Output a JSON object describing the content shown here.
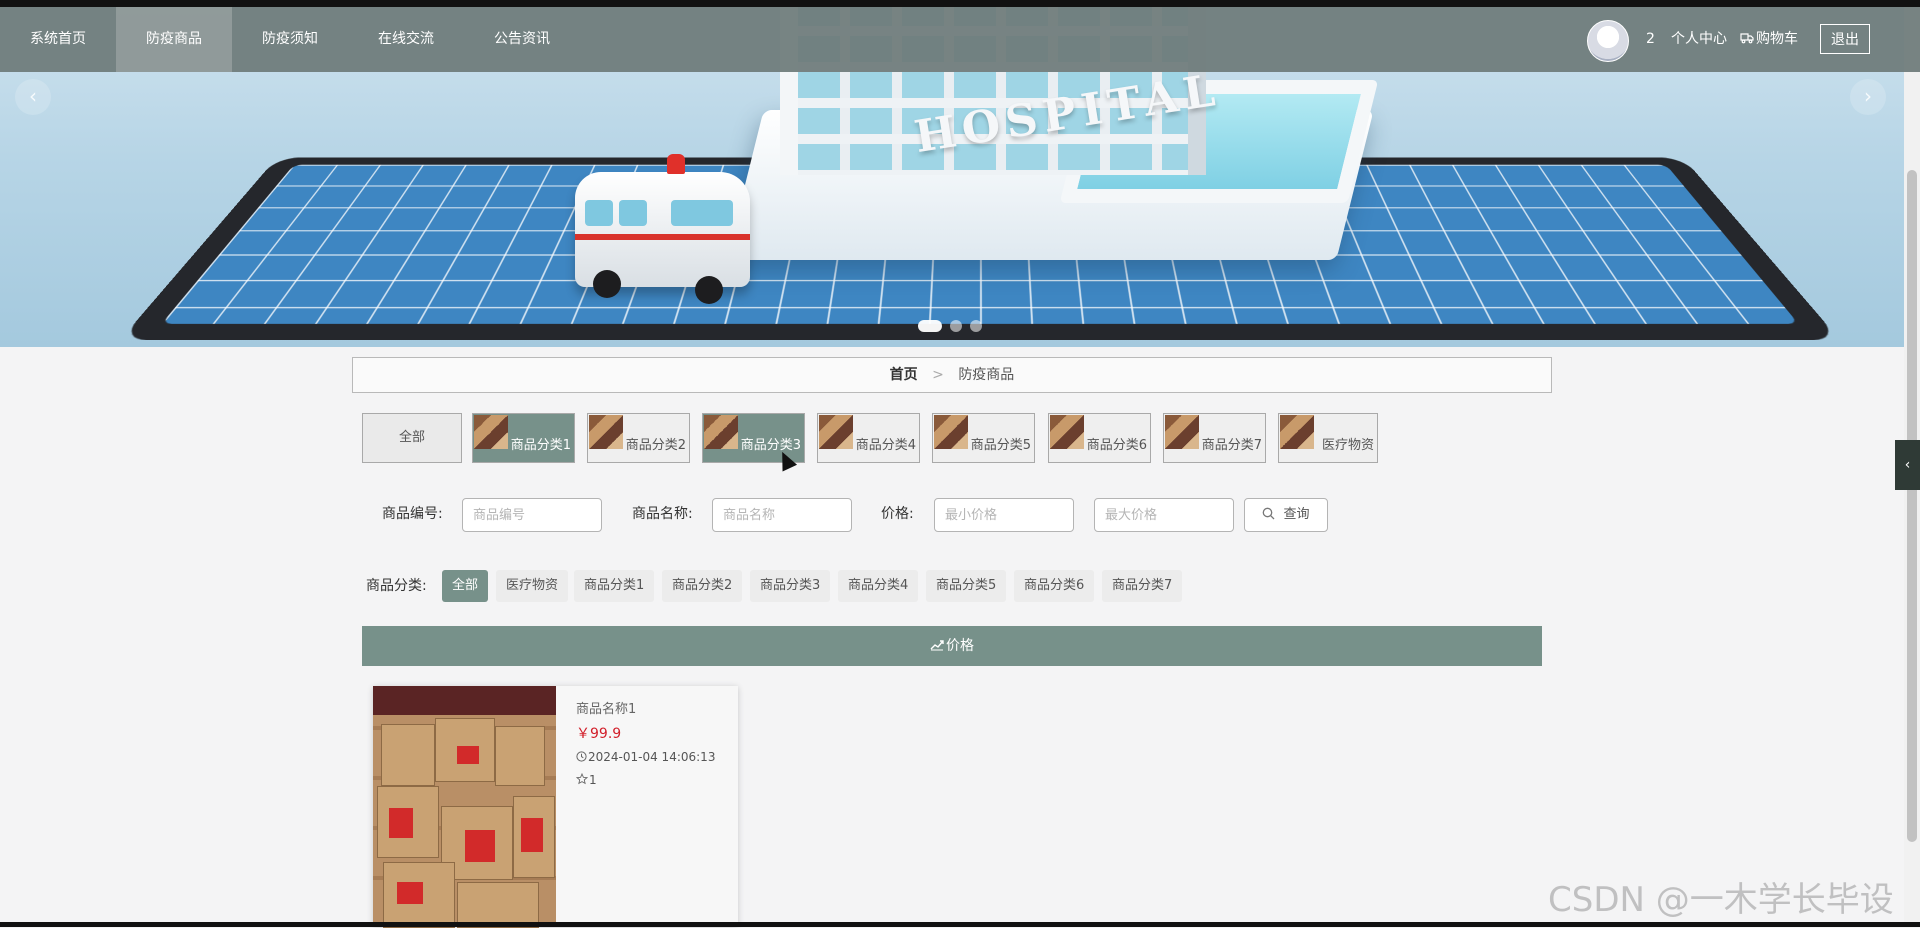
{
  "nav": {
    "items": [
      {
        "label": "系统首页"
      },
      {
        "label": "防疫商品"
      },
      {
        "label": "防疫须知"
      },
      {
        "label": "在线交流"
      },
      {
        "label": "公告资讯"
      }
    ],
    "user_count": "2",
    "personal_center": "个人中心",
    "cart_icon": "truck-icon",
    "cart": "购物车",
    "logout": "退出"
  },
  "banner": {
    "sign_text": "HOSPITAL",
    "prev_arrow": "‹",
    "next_arrow": "›",
    "slide_count": 3,
    "active_slide": 1
  },
  "breadcrumb": {
    "home": "首页",
    "separator": ">",
    "current": "防疫商品"
  },
  "category_tabs": [
    {
      "label": "全部"
    },
    {
      "label": "商品分类1"
    },
    {
      "label": "商品分类2"
    },
    {
      "label": "商品分类3"
    },
    {
      "label": "商品分类4"
    },
    {
      "label": "商品分类5"
    },
    {
      "label": "商品分类6"
    },
    {
      "label": "商品分类7"
    },
    {
      "label": "医疗物资"
    }
  ],
  "search": {
    "code_label": "商品编号:",
    "code_placeholder": "商品编号",
    "name_label": "商品名称:",
    "name_placeholder": "商品名称",
    "price_label": "价格:",
    "min_placeholder": "最小价格",
    "max_placeholder": "最大价格",
    "query_icon": "search-icon",
    "query_button": "查询"
  },
  "filter": {
    "label": "商品分类:",
    "chips": [
      "全部",
      "医疗物资",
      "商品分类1",
      "商品分类2",
      "商品分类3",
      "商品分类4",
      "商品分类5",
      "商品分类6",
      "商品分类7"
    ]
  },
  "sort": {
    "icon": "trend-chart-icon",
    "label": "价格"
  },
  "products": [
    {
      "name": "商品名称1",
      "price": "￥99.9",
      "time": "2024-01-04 14:06:13",
      "favorites": "1"
    }
  ],
  "side_toggle": "‹",
  "watermark": "CSDN @一木学长毕设",
  "colors": {
    "accent": "#77918a",
    "nav_bg": "#6c7a78",
    "price": "#d21f2a"
  }
}
